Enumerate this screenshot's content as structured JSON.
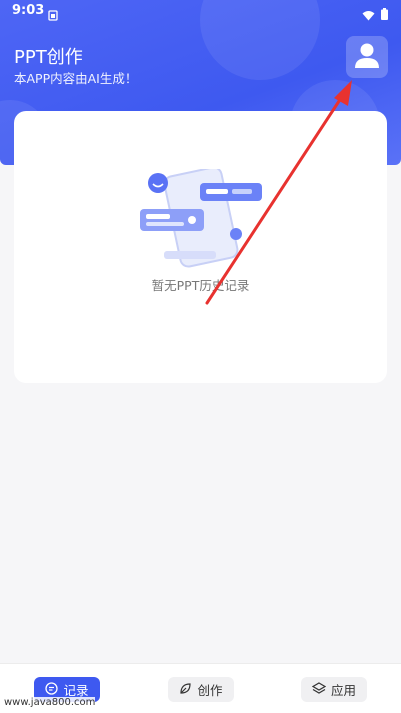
{
  "status_bar": {
    "time": "9:03"
  },
  "header": {
    "title": "PPT创作",
    "subtitle": "本APP内容由AI生成！"
  },
  "empty_state": {
    "text": "暂无PPT历史记录"
  },
  "tabs": [
    {
      "label": "记录",
      "icon": "message-icon",
      "active": true
    },
    {
      "label": "创作",
      "icon": "leaf-icon",
      "active": false
    },
    {
      "label": "应用",
      "icon": "layers-icon",
      "active": false
    }
  ],
  "watermark": "www.java800.com",
  "colors": {
    "primary": "#3e59f0",
    "annotation_arrow": "#e8322f",
    "background": "#f6f6f8"
  }
}
